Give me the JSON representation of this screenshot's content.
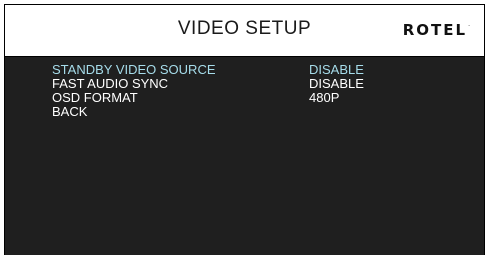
{
  "header": {
    "title": "VIDEO SETUP",
    "brand": "ROTEL",
    "brand_mark": "."
  },
  "menu": {
    "items": [
      {
        "label": "STANDBY VIDEO SOURCE",
        "value": "DISABLE",
        "selected": true
      },
      {
        "label": "FAST AUDIO SYNC",
        "value": "DISABLE",
        "selected": false
      },
      {
        "label": "OSD FORMAT",
        "value": "480P",
        "selected": false
      },
      {
        "label": "BACK",
        "value": "",
        "selected": false
      }
    ]
  },
  "colors": {
    "background": "#1f1f1f",
    "header_background": "#ffffff",
    "text": "#ffffff",
    "selected_text": "#a6dcea"
  }
}
